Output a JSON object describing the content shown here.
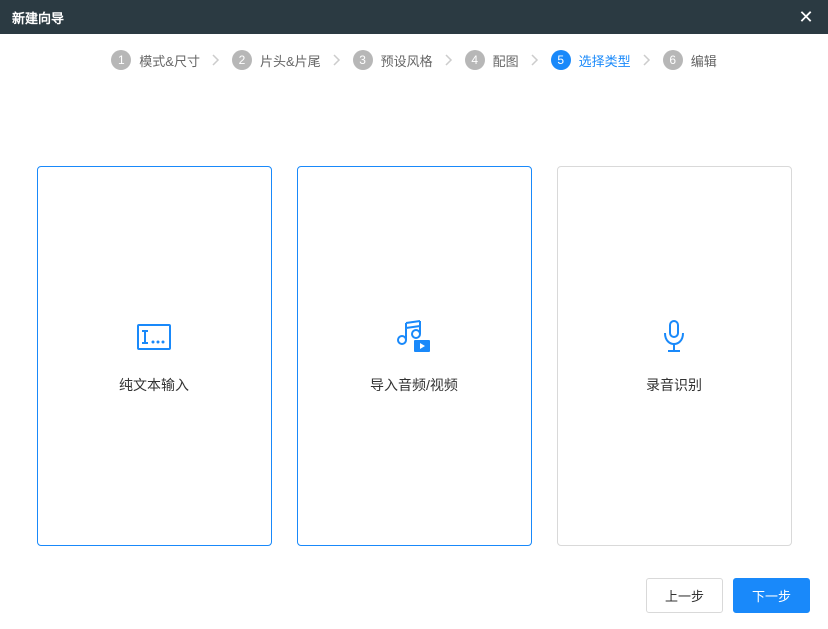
{
  "titlebar": {
    "title": "新建向导"
  },
  "steps": [
    {
      "num": "1",
      "label": "模式&尺寸"
    },
    {
      "num": "2",
      "label": "片头&片尾"
    },
    {
      "num": "3",
      "label": "预设风格"
    },
    {
      "num": "4",
      "label": "配图"
    },
    {
      "num": "5",
      "label": "选择类型"
    },
    {
      "num": "6",
      "label": "编辑"
    }
  ],
  "cards": {
    "text": "纯文本输入",
    "import": "导入音频/视频",
    "record": "录音识别"
  },
  "footer": {
    "prev": "上一步",
    "next": "下一步"
  }
}
